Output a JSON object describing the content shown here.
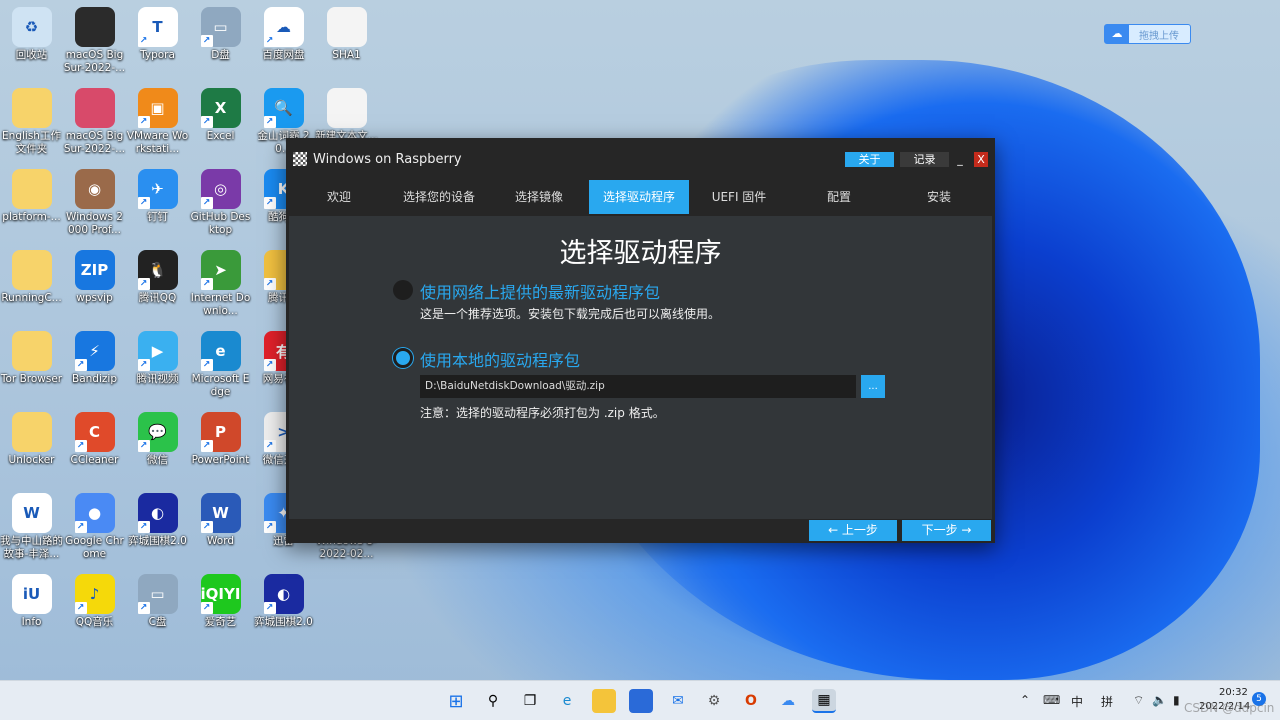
{
  "desktop": {
    "icons": [
      {
        "label": "回收站",
        "c": "#cfe3f3",
        "g": "♻",
        "col": 0,
        "row": 0,
        "sc": false
      },
      {
        "label": "English工作文件夹",
        "c": "#f7d36a",
        "g": "",
        "col": 0,
        "row": 1,
        "sc": false
      },
      {
        "label": "platform-...",
        "c": "#f7d36a",
        "g": "",
        "col": 0,
        "row": 2,
        "sc": false
      },
      {
        "label": "RunningC...",
        "c": "#f7d36a",
        "g": "",
        "col": 0,
        "row": 3,
        "sc": false
      },
      {
        "label": "Tor Browser",
        "c": "#f7d36a",
        "g": "",
        "col": 0,
        "row": 4,
        "sc": false
      },
      {
        "label": "Unlocker",
        "c": "#f7d36a",
        "g": "",
        "col": 0,
        "row": 5,
        "sc": false
      },
      {
        "label": "我与中山路的故事-丰泽...",
        "c": "#ffffff",
        "g": "W",
        "col": 0,
        "row": 6,
        "sc": false
      },
      {
        "label": "Info",
        "c": "#ffffff",
        "g": "iU",
        "col": 0,
        "row": 7,
        "sc": false
      },
      {
        "label": "macOS Big Sur-2022-...",
        "c": "#2b2b2b",
        "g": "",
        "col": 1,
        "row": 0,
        "sc": false
      },
      {
        "label": "macOS Big Sur-2022-...",
        "c": "#d84a6a",
        "g": "",
        "col": 1,
        "row": 1,
        "sc": false
      },
      {
        "label": "Windows 2000 Prof...",
        "c": "#9a6a4a",
        "g": "◉",
        "col": 1,
        "row": 2,
        "sc": false
      },
      {
        "label": "wpsvip",
        "c": "#1877e0",
        "g": "ZIP",
        "col": 1,
        "row": 3,
        "sc": false
      },
      {
        "label": "Bandizip",
        "c": "#1877e0",
        "g": "⚡",
        "col": 1,
        "row": 4,
        "sc": true
      },
      {
        "label": "CCleaner",
        "c": "#e04a2a",
        "g": "C",
        "col": 1,
        "row": 5,
        "sc": true
      },
      {
        "label": "Google Chrome",
        "c": "#4a8af4",
        "g": "●",
        "col": 1,
        "row": 6,
        "sc": true
      },
      {
        "label": "QQ音乐",
        "c": "#f5d90a",
        "g": "♪",
        "col": 1,
        "row": 7,
        "sc": true
      },
      {
        "label": "Typora",
        "c": "#ffffff",
        "g": "T",
        "col": 2,
        "row": 0,
        "sc": true
      },
      {
        "label": "VMware Workstati...",
        "c": "#f08a1a",
        "g": "▣",
        "col": 2,
        "row": 1,
        "sc": true
      },
      {
        "label": "钉钉",
        "c": "#2a8ff0",
        "g": "✈",
        "col": 2,
        "row": 2,
        "sc": true
      },
      {
        "label": "腾讯QQ",
        "c": "#222222",
        "g": "🐧",
        "col": 2,
        "row": 3,
        "sc": true
      },
      {
        "label": "腾讯视频",
        "c": "#3ab0f0",
        "g": "▶",
        "col": 2,
        "row": 4,
        "sc": true
      },
      {
        "label": "微信",
        "c": "#2bc24a",
        "g": "💬",
        "col": 2,
        "row": 5,
        "sc": true
      },
      {
        "label": "弈城围棋2.0",
        "c": "#1a2aa0",
        "g": "◐",
        "col": 2,
        "row": 6,
        "sc": true
      },
      {
        "label": "C盘",
        "c": "#8fa8c0",
        "g": "▭",
        "col": 2,
        "row": 7,
        "sc": true
      },
      {
        "label": "D盘",
        "c": "#8fa8c0",
        "g": "▭",
        "col": 3,
        "row": 0,
        "sc": true
      },
      {
        "label": "Excel",
        "c": "#1e7a45",
        "g": "X",
        "col": 3,
        "row": 1,
        "sc": true
      },
      {
        "label": "GitHub Desktop",
        "c": "#7a3aa8",
        "g": "◎",
        "col": 3,
        "row": 2,
        "sc": true
      },
      {
        "label": "Internet Downlo...",
        "c": "#3a9a3a",
        "g": "➤",
        "col": 3,
        "row": 3,
        "sc": true
      },
      {
        "label": "Microsoft Edge",
        "c": "#1a8ad0",
        "g": "e",
        "col": 3,
        "row": 4,
        "sc": true
      },
      {
        "label": "PowerPoint",
        "c": "#d0482a",
        "g": "P",
        "col": 3,
        "row": 5,
        "sc": true
      },
      {
        "label": "Word",
        "c": "#2a5ab8",
        "g": "W",
        "col": 3,
        "row": 6,
        "sc": true
      },
      {
        "label": "爱奇艺",
        "c": "#1ec81e",
        "g": "iQIYI",
        "col": 3,
        "row": 7,
        "sc": true
      },
      {
        "label": "百度网盘",
        "c": "#ffffff",
        "g": "☁",
        "col": 4,
        "row": 0,
        "sc": true
      },
      {
        "label": "金山词霸 20...",
        "c": "#1a9af0",
        "g": "🔍",
        "col": 4,
        "row": 1,
        "sc": true
      },
      {
        "label": "酷狗...",
        "c": "#1a8af0",
        "g": "K",
        "col": 4,
        "row": 2,
        "sc": true
      },
      {
        "label": "腾讯...",
        "c": "#f0c040",
        "g": "",
        "col": 4,
        "row": 3,
        "sc": true
      },
      {
        "label": "网易有...",
        "c": "#e0202a",
        "g": "有",
        "col": 4,
        "row": 4,
        "sc": true
      },
      {
        "label": "微信开...",
        "c": "#eeeeee",
        "g": ">",
        "col": 4,
        "row": 5,
        "sc": true
      },
      {
        "label": "迅雷",
        "c": "#3a8af0",
        "g": "✦",
        "col": 4,
        "row": 6,
        "sc": true
      },
      {
        "label": "弈城围棋2.0",
        "c": "#1a2aa0",
        "g": "◐",
        "col": 4,
        "row": 7,
        "sc": true
      },
      {
        "label": "SHA1",
        "c": "#f4f4f4",
        "g": "",
        "col": 5,
        "row": 0,
        "sc": false
      },
      {
        "label": "新建文本文...",
        "c": "#f4f4f4",
        "g": "",
        "col": 5,
        "row": 1,
        "sc": false
      },
      {
        "label": "Windows 8-2022-02...",
        "c": "transparent",
        "g": "",
        "col": 5,
        "row": 6,
        "sc": false
      }
    ]
  },
  "baidu_widget": {
    "label": "拖拽上传"
  },
  "window": {
    "title": "Windows on Raspberry",
    "about": "关于",
    "log": "记录",
    "minimize": "_",
    "close": "X",
    "tabs": [
      "欢迎",
      "选择您的设备",
      "选择镜像",
      "选择驱动程序",
      "UEFI 固件",
      "配置",
      "安装"
    ],
    "active_tab": 3,
    "heading": "选择驱动程序",
    "option1": {
      "label": "使用网络上提供的最新驱动程序包",
      "desc": "这是一个推荐选项。安装包下载完成后也可以离线使用。",
      "selected": false
    },
    "option2": {
      "label": "使用本地的驱动程序包",
      "selected": true
    },
    "path_value": "D:\\BaiduNetdiskDownload\\驱动.zip",
    "browse": "...",
    "note": "注意：选择的驱动程序必须打包为 .zip 格式。",
    "prev": "← 上一步",
    "next": "下一步 →"
  },
  "taskbar": {
    "lang1": "中",
    "lang2": "拼",
    "time": "20:32",
    "date": "2022/2/14",
    "notif": "5",
    "watermark": "CSDN @ddpcin"
  },
  "colors": {
    "accent": "#29a8ef",
    "window_bg": "#323639",
    "titlebar": "#262626",
    "close": "#c42b1c"
  }
}
